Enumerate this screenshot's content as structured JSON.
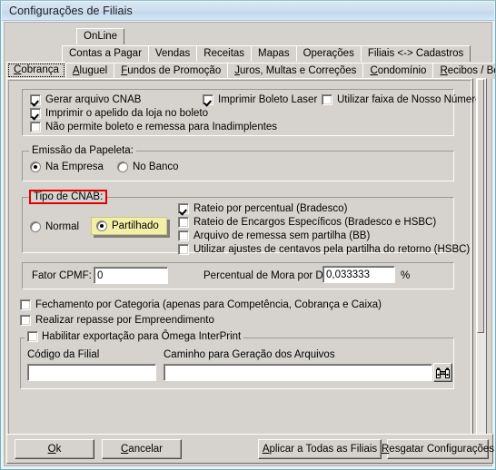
{
  "window": {
    "title": "Configurações de Filiais"
  },
  "tabs": {
    "row1": [
      {
        "label": "OnLine",
        "selected": false
      }
    ],
    "row2": [
      {
        "label": "Contas a Pagar",
        "selected": false
      },
      {
        "label": "Vendas",
        "selected": false
      },
      {
        "label": "Receitas",
        "selected": false
      },
      {
        "label": "Mapas",
        "selected": false
      },
      {
        "label": "Operações",
        "selected": false
      },
      {
        "label": "Filiais <-> Cadastros",
        "selected": false
      }
    ],
    "row3": [
      {
        "label": "Cobrança",
        "selected": true
      },
      {
        "label": "Aluguel",
        "selected": false
      },
      {
        "label": "Fundos de Promoção",
        "selected": false
      },
      {
        "label": "Juros, Multas e Correções",
        "selected": false
      },
      {
        "label": "Condomínio",
        "selected": false
      },
      {
        "label": "Recibos / Boletos",
        "selected": false
      }
    ]
  },
  "options_group": {
    "items": [
      {
        "label": "Gerar arquivo CNAB",
        "checked": true
      },
      {
        "label": "Imprimir Boleto Laser",
        "checked": true
      },
      {
        "label": "Utilizar faixa de Nosso Número",
        "checked": false
      },
      {
        "label": "Imprimir o apelido da loja no boleto",
        "checked": true
      },
      {
        "label": "Não permite boleto e remessa para Inadimplentes",
        "checked": false
      }
    ]
  },
  "emissao_group": {
    "legend": "Emissão da Papeleta:",
    "options": [
      {
        "label": "Na Empresa",
        "selected": true
      },
      {
        "label": "No Banco",
        "selected": false
      }
    ]
  },
  "cnab_group": {
    "legend": "Tipo de CNAB:",
    "highlight_color": "#e00000",
    "radios": [
      {
        "label": "Normal",
        "selected": false,
        "highlighted": false
      },
      {
        "label": "Partilhado",
        "selected": true,
        "highlighted": true,
        "highlight_color": "#f2f0a8"
      }
    ],
    "checks": [
      {
        "label": "Rateio por percentual (Bradesco)",
        "checked": true
      },
      {
        "label": "Rateio de Encargos Específicos (Bradesco e HSBC)",
        "checked": false
      },
      {
        "label": "Arquivo de remessa sem partilha (BB)",
        "checked": false
      },
      {
        "label": "Utilizar ajustes de centavos pela partilha do retorno (HSBC)",
        "checked": false
      }
    ]
  },
  "fields_group": {
    "fator_cpmf_label": "Fator CPMF:",
    "fator_cpmf_value": "0",
    "mora_label": "Percentual de Mora por Dia:",
    "mora_value": "0,033333",
    "mora_suffix": "%"
  },
  "extra_checks": [
    {
      "label": "Fechamento por Categoria (apenas para Competência, Cobrança e Caixa)",
      "checked": false
    },
    {
      "label": "Realizar repasse por Empreendimento",
      "checked": false
    }
  ],
  "omega_group": {
    "legend": "Habilitar exportação para Ômega InterPrint",
    "legend_checked": false,
    "codigo_label": "Código da Filial",
    "codigo_value": "",
    "caminho_label": "Caminho para Geração dos Arquivos",
    "caminho_value": "",
    "browse_icon": "binoculars-icon"
  },
  "buttons": {
    "ok": {
      "label": "Ok",
      "accel": "O"
    },
    "cancelar": {
      "label": "Cancelar",
      "accel": "C"
    },
    "aplicar": {
      "label": "Aplicar a Todas as Filiais",
      "accel": "A"
    },
    "resgatar": {
      "label": "Resgatar Configurações",
      "accel": "R"
    }
  }
}
